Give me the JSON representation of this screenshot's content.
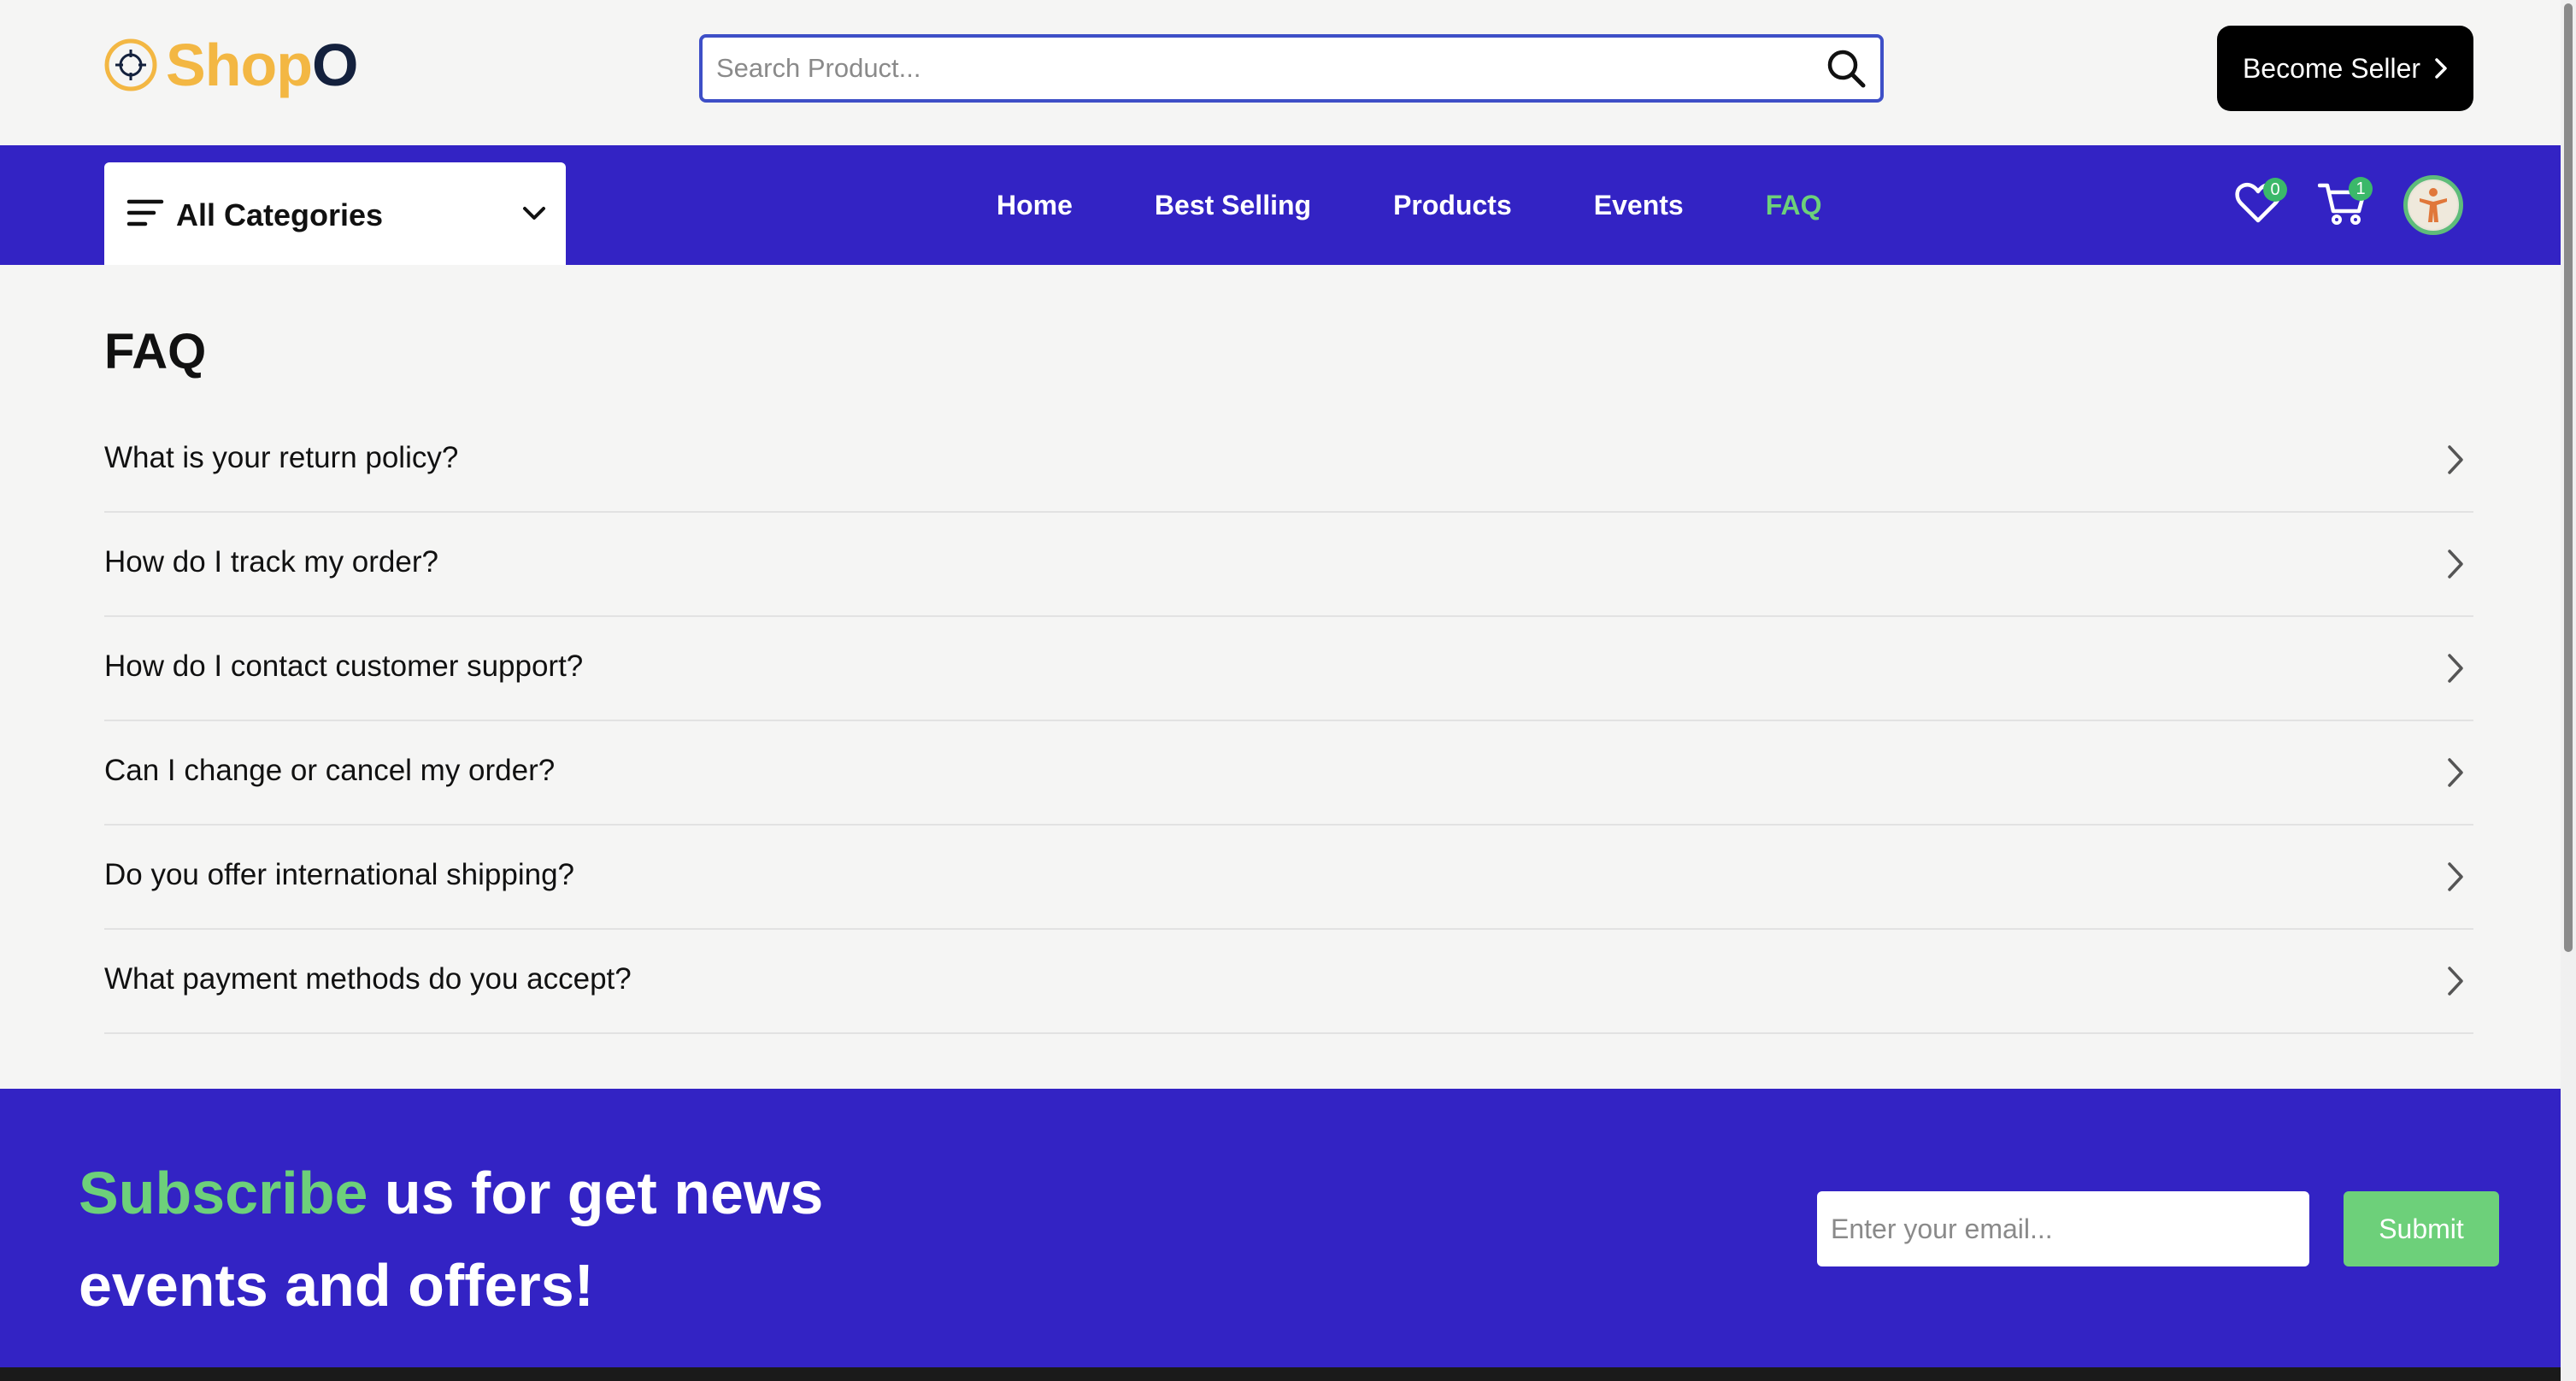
{
  "header": {
    "logo_part1": "Shop",
    "logo_part2": "O",
    "search_placeholder": "Search Product...",
    "seller_button": "Become Seller"
  },
  "nav": {
    "categories_label": "All Categories",
    "links": [
      {
        "label": "Home",
        "active": false
      },
      {
        "label": "Best Selling",
        "active": false
      },
      {
        "label": "Products",
        "active": false
      },
      {
        "label": "Events",
        "active": false
      },
      {
        "label": "FAQ",
        "active": true
      }
    ],
    "wishlist_count": "0",
    "cart_count": "1"
  },
  "faq": {
    "title": "FAQ",
    "questions": [
      "What is your return policy?",
      "How do I track my order?",
      "How do I contact customer support?",
      "Can I change or cancel my order?",
      "Do you offer international shipping?",
      "What payment methods do you accept?"
    ]
  },
  "subscribe": {
    "highlight": "Subscribe",
    "line1_rest": " us for get news",
    "line2": "events and offers!",
    "email_placeholder": "Enter your email...",
    "submit_label": "Submit"
  },
  "colors": {
    "brand_blue": "#3323c4",
    "accent_green": "#6dd07a",
    "logo_orange": "#f3b743",
    "logo_navy": "#14213d"
  },
  "icons": {
    "search": "search-icon",
    "chevron_right": "chevron-right-icon",
    "menu": "menu-icon",
    "chevron_down": "chevron-down-icon",
    "heart": "heart-icon",
    "cart": "cart-icon",
    "avatar": "avatar-icon"
  }
}
